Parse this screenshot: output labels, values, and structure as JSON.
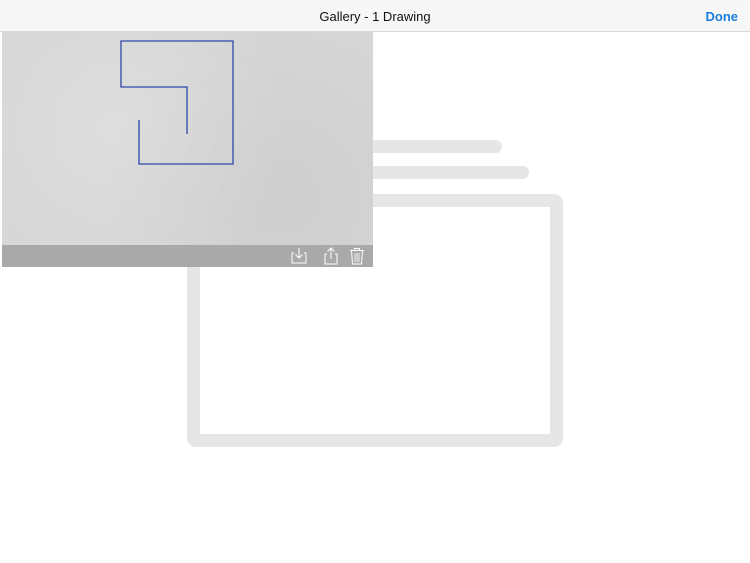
{
  "navbar": {
    "title": "Gallery - 1 Drawing",
    "done_label": "Done"
  },
  "colors": {
    "accent": "#1a7fdc",
    "stroke": "#2e47a8",
    "card_background": "#d6d6d6",
    "toolbar_background": "#a9a9a9",
    "placeholder": "#e6e6e6"
  },
  "gallery": {
    "drawings": [
      {
        "toolbar_icons": [
          "save-to-photos-icon",
          "share-icon",
          "trash-icon"
        ]
      }
    ]
  }
}
